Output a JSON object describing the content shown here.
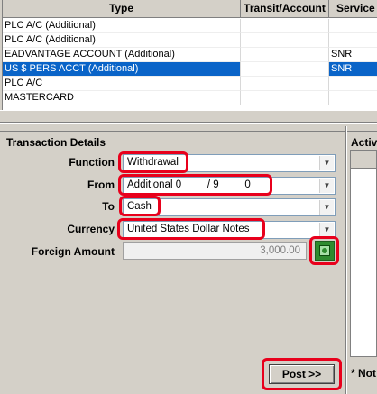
{
  "grid": {
    "columns": {
      "type": "Type",
      "transit": "Transit/Account",
      "service": "Service T"
    },
    "rows": [
      {
        "type": "PLC A/C (Additional)",
        "transit": "",
        "service": ""
      },
      {
        "type": "PLC A/C (Additional)",
        "transit": "",
        "service": ""
      },
      {
        "type": "EADVANTAGE ACCOUNT (Additional)",
        "transit": "",
        "service": "SNR"
      },
      {
        "type": "US $ PERS ACCT (Additional)",
        "transit": "",
        "service": "SNR"
      },
      {
        "type": "PLC A/C",
        "transit": "",
        "service": ""
      },
      {
        "type": "MASTERCARD",
        "transit": "",
        "service": ""
      }
    ],
    "selected_row": 3
  },
  "transaction": {
    "title": "Transaction Details",
    "function_label": "Function",
    "function_value": "Withdrawal",
    "from_label": "From",
    "from_value": "Additional 0         / 9         0",
    "to_label": "To",
    "to_value": "Cash",
    "currency_label": "Currency",
    "currency_value": "United States Dollar Notes",
    "foreign_amount_label": "Foreign Amount",
    "foreign_amount_value": "3,000.00"
  },
  "activity": {
    "title": "Activ"
  },
  "post_button": "Post >>",
  "note": "* Not",
  "colors": {
    "selection": "#0a64c8",
    "highlight": "#e8001c",
    "background": "#d4d0c8"
  },
  "icons": {
    "calculator": "calculator-icon",
    "dropdown": "chevron-down-icon"
  }
}
